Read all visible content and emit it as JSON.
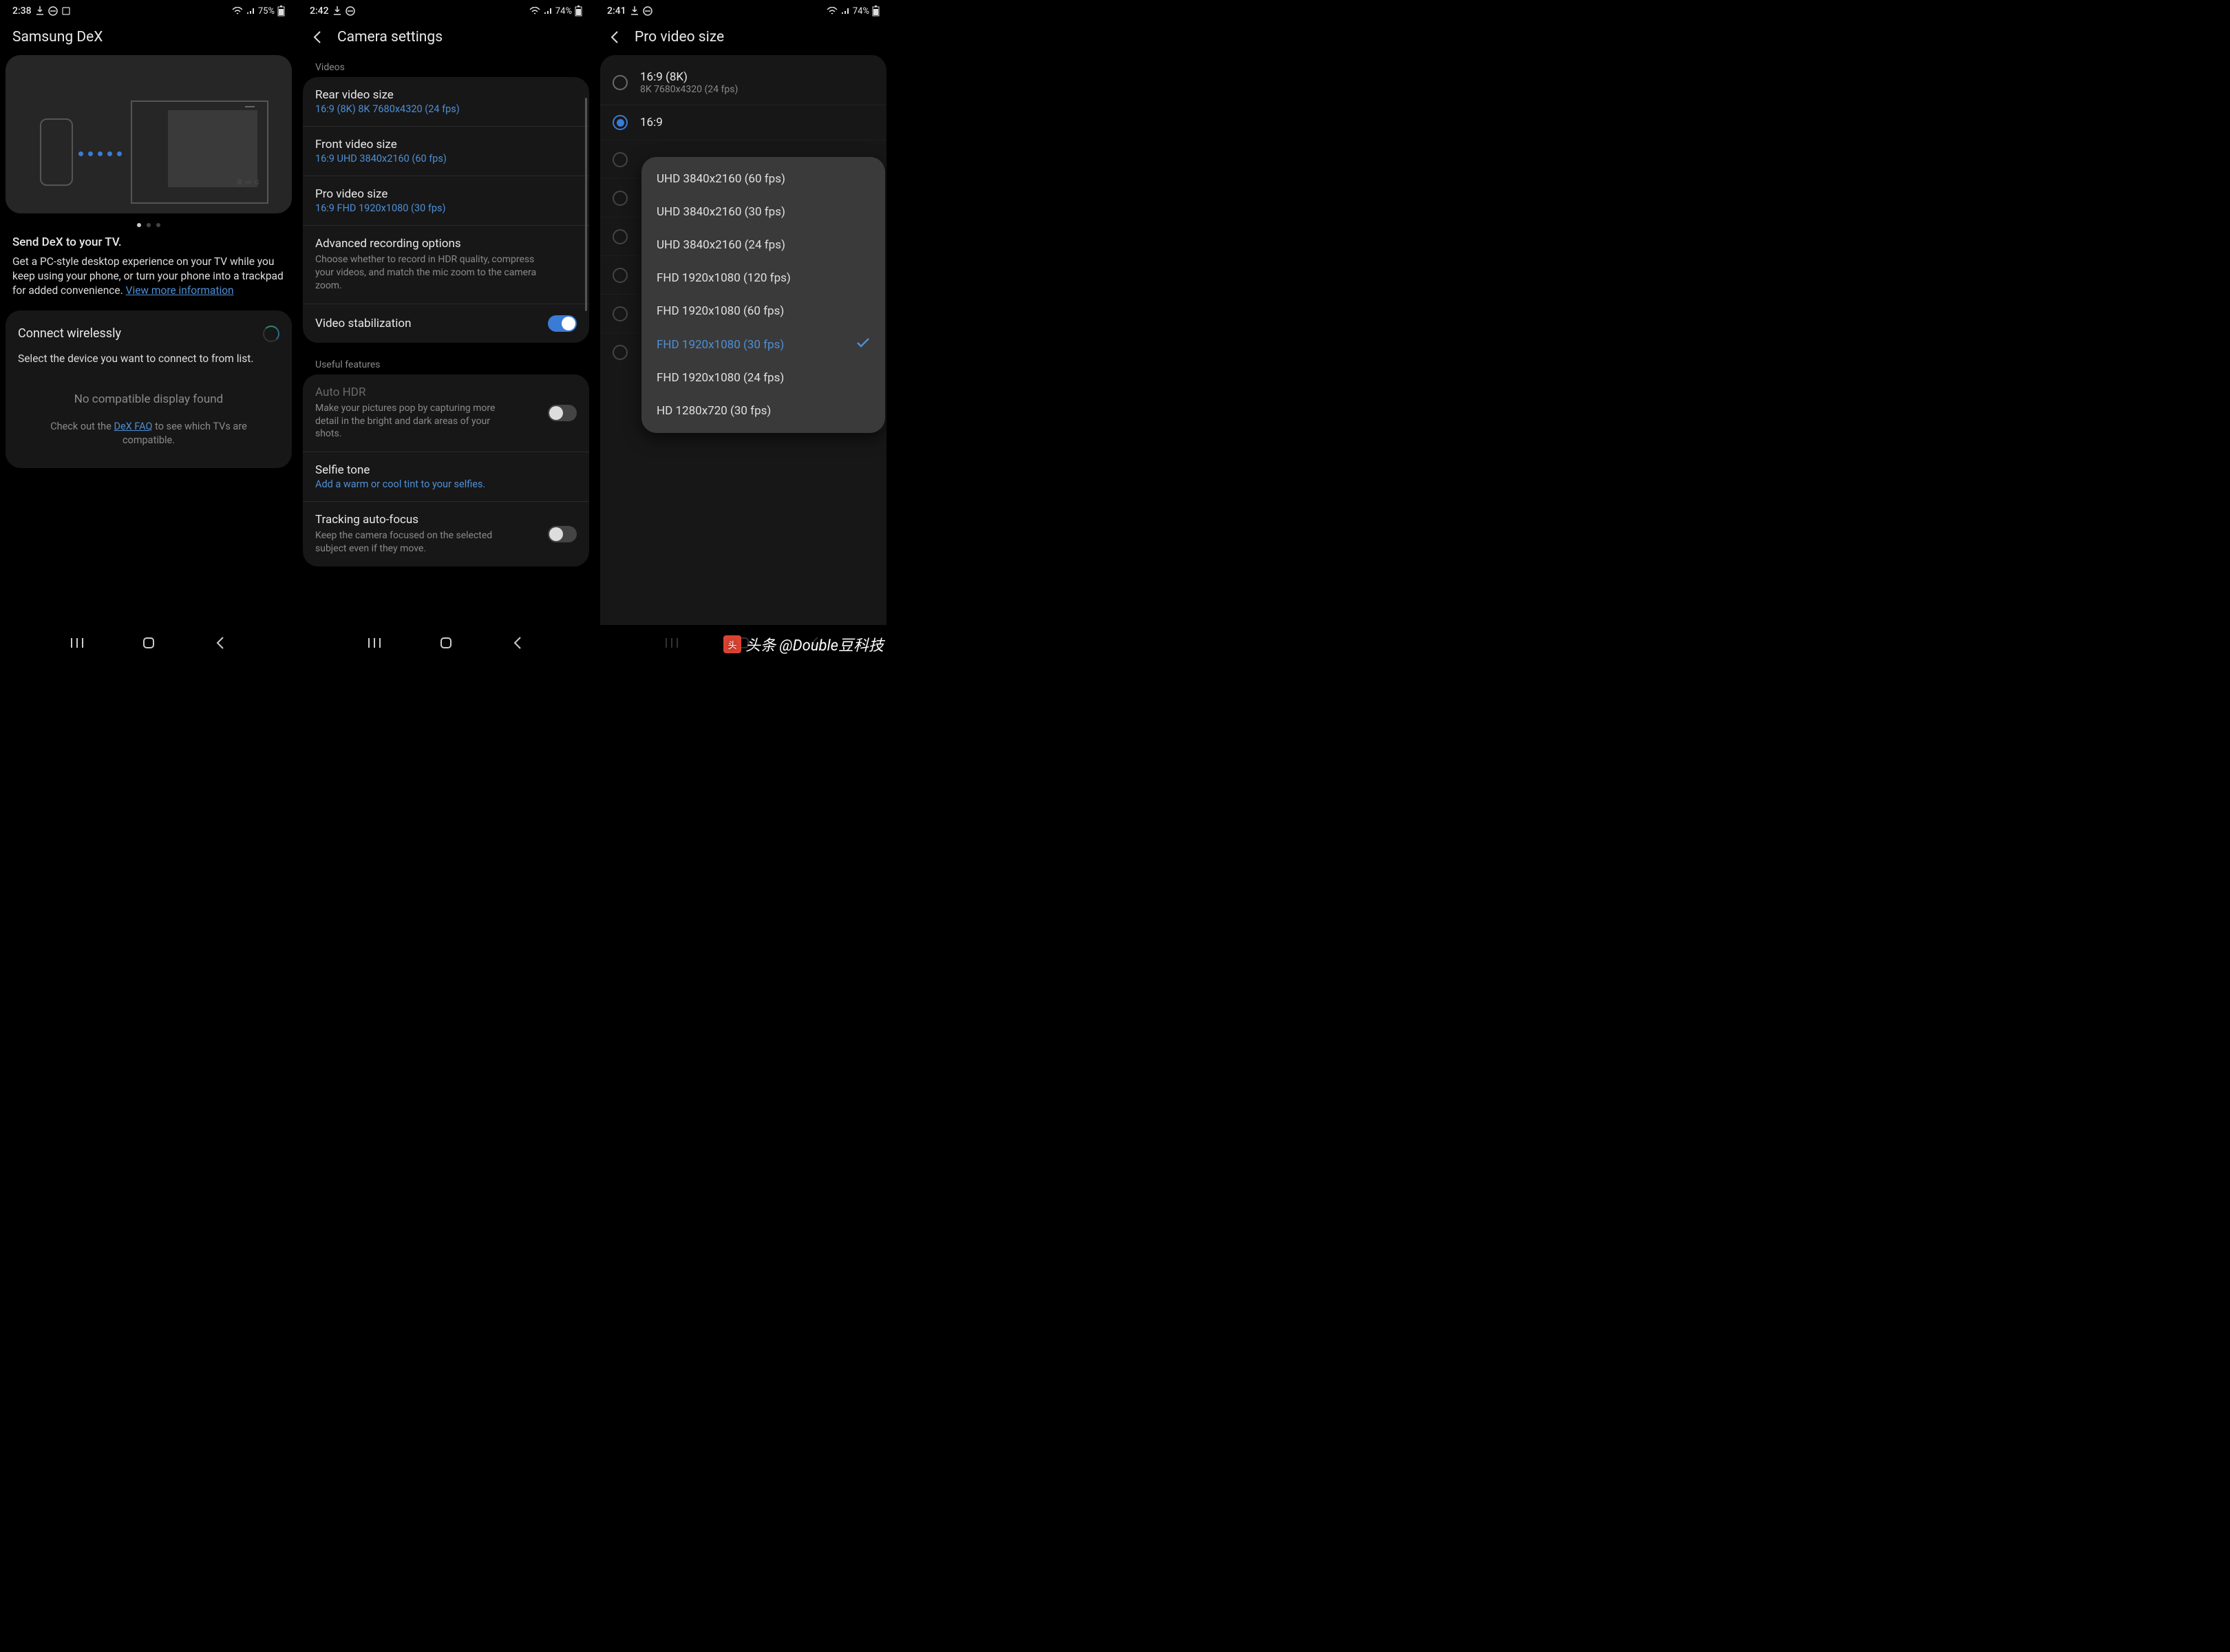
{
  "screens": {
    "left": {
      "status": {
        "time": "2:38",
        "battery": "75%"
      },
      "title": "Samsung DeX",
      "desc_title": "Send DeX to your TV.",
      "desc_body": "Get a PC-style desktop experience on your TV while you keep using your phone, or turn your phone into a trackpad for added convenience.",
      "more_link": "View more information",
      "connect_title": "Connect wirelessly",
      "connect_sub": "Select the device you want to connect to from list.",
      "empty": "No compatible display found",
      "faq_pre": "Check out the ",
      "faq_link": "DeX FAQ",
      "faq_post": " to see which TVs are compatible."
    },
    "mid": {
      "status": {
        "time": "2:42",
        "battery": "74%"
      },
      "title": "Camera settings",
      "sec_videos": "Videos",
      "rear_title": "Rear video size",
      "rear_sub": "16:9 (8K) 8K 7680x4320 (24 fps)",
      "front_title": "Front video size",
      "front_sub": "16:9 UHD 3840x2160 (60 fps)",
      "pro_title": "Pro video size",
      "pro_sub": "16:9 FHD 1920x1080 (30 fps)",
      "adv_title": "Advanced recording options",
      "adv_desc": "Choose whether to record in HDR quality, compress your videos, and match the mic zoom to the camera zoom.",
      "stab_title": "Video stabilization",
      "sec_useful": "Useful features",
      "auto_hdr_title": "Auto HDR",
      "auto_hdr_desc": "Make your pictures pop by capturing more detail in the bright and dark areas of your shots.",
      "selfie_title": "Selfie tone",
      "selfie_sub": "Add a warm or cool tint to your selfies.",
      "track_title": "Tracking auto-focus",
      "track_desc": "Keep the camera focused on the selected subject even if they move."
    },
    "right": {
      "status": {
        "time": "2:41",
        "battery": "74%"
      },
      "title": "Pro video size",
      "radios": [
        {
          "label": "16:9 (8K)",
          "sub": "8K 7680x4320 (24 fps)",
          "checked": false
        },
        {
          "label": "16:9",
          "sub": "",
          "checked": true
        }
      ],
      "popup": [
        "UHD 3840x2160 (60 fps)",
        "UHD 3840x2160 (30 fps)",
        "UHD 3840x2160 (24 fps)",
        "FHD 1920x1080 (120 fps)",
        "FHD 1920x1080 (60 fps)",
        "FHD 1920x1080 (30 fps)",
        "FHD 1920x1080 (24 fps)",
        "HD 1280x720 (30 fps)"
      ],
      "selected_popup_index": 5
    }
  },
  "watermark": "头条 @Double豆科技"
}
